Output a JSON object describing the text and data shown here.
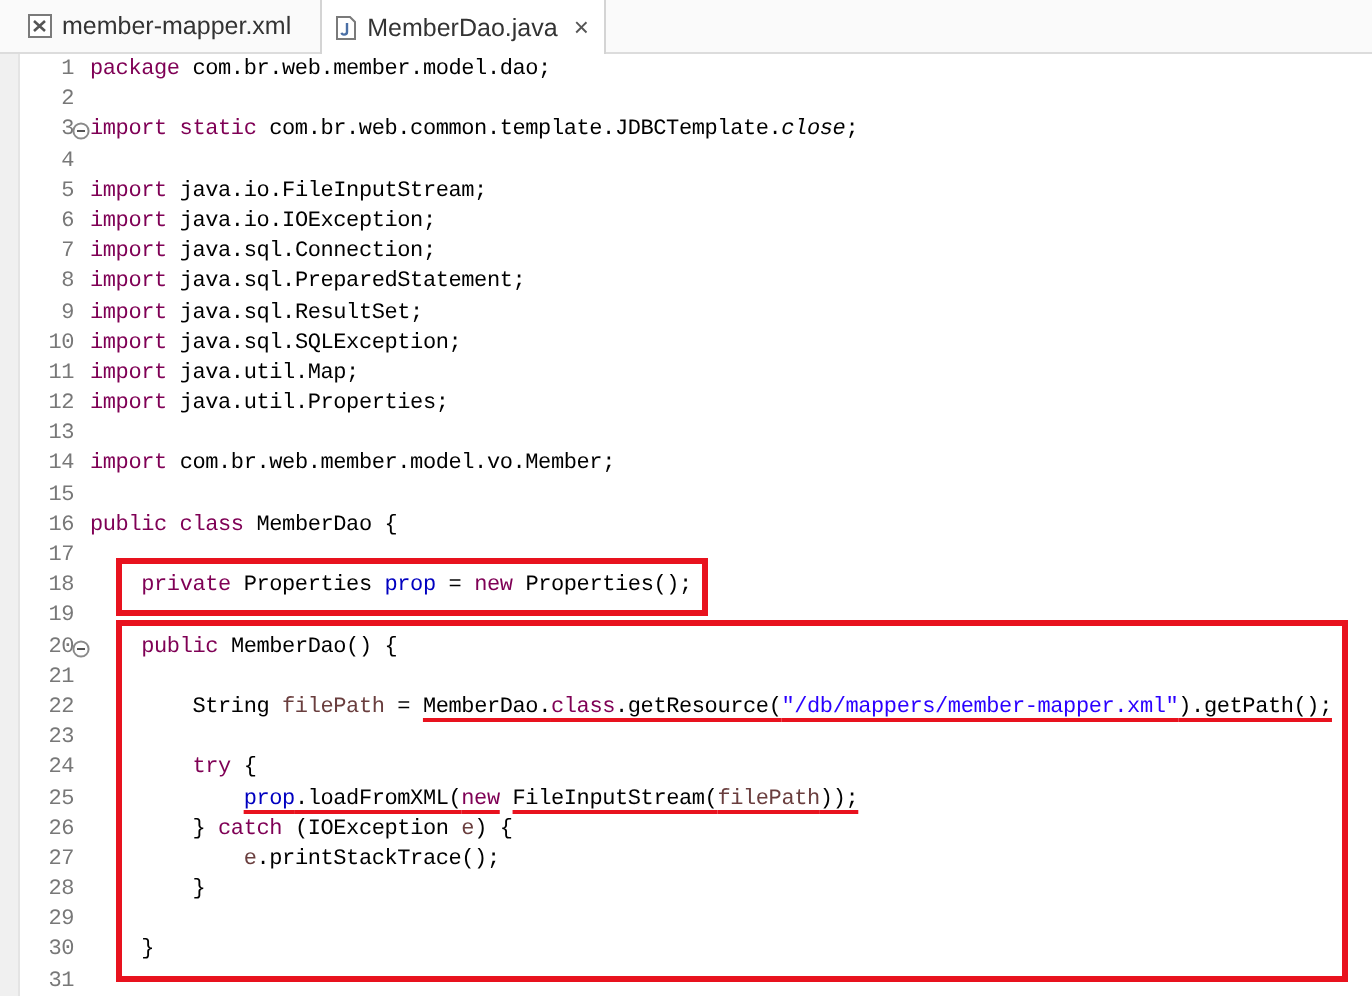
{
  "tabs": [
    {
      "label": "member-mapper.xml",
      "kind": "xml",
      "selected": false
    },
    {
      "label": "MemberDao.java",
      "kind": "java",
      "selected": true
    }
  ],
  "close_glyph": "×",
  "code": [
    {
      "kind": "plain",
      "lines": [
        {
          "number": "1",
          "tokens": [
            {
              "kind": "keyword",
              "text": "package"
            },
            {
              "kind": "plain",
              "text": " com.br.web.member.model.dao;"
            }
          ]
        },
        {
          "number": "2"
        },
        {
          "number": "3",
          "fold": true,
          "tokens": [
            {
              "kind": "keyword",
              "text": "import static"
            },
            {
              "kind": "plain",
              "text": " com.br.web.common.template.JDBCTemplate."
            },
            {
              "kind": "static",
              "text": "close"
            },
            {
              "kind": "plain",
              "text": ";"
            }
          ]
        },
        {
          "number": "4"
        },
        {
          "number": "5",
          "tokens": [
            {
              "kind": "keyword",
              "text": "import"
            },
            {
              "kind": "plain",
              "text": " java.io.FileInputStream;"
            }
          ]
        },
        {
          "number": "6",
          "tokens": [
            {
              "kind": "keyword",
              "text": "import"
            },
            {
              "kind": "plain",
              "text": " java.io.IOException;"
            }
          ]
        },
        {
          "number": "7",
          "tokens": [
            {
              "kind": "keyword",
              "text": "import"
            },
            {
              "kind": "plain",
              "text": " java.sql.Connection;"
            }
          ]
        },
        {
          "number": "8",
          "tokens": [
            {
              "kind": "keyword",
              "text": "import"
            },
            {
              "kind": "plain",
              "text": " java.sql.PreparedStatement;"
            }
          ]
        },
        {
          "number": "9",
          "tokens": [
            {
              "kind": "keyword",
              "text": "import"
            },
            {
              "kind": "plain",
              "text": " java.sql.ResultSet;"
            }
          ]
        },
        {
          "number": "10",
          "tokens": [
            {
              "kind": "keyword",
              "text": "import"
            },
            {
              "kind": "plain",
              "text": " java.sql.SQLException;"
            }
          ]
        },
        {
          "number": "11",
          "tokens": [
            {
              "kind": "keyword",
              "text": "import"
            },
            {
              "kind": "plain",
              "text": " java.util.Map;"
            }
          ]
        },
        {
          "number": "12",
          "tokens": [
            {
              "kind": "keyword",
              "text": "import"
            },
            {
              "kind": "plain",
              "text": " java.util.Properties;"
            }
          ]
        },
        {
          "number": "13"
        },
        {
          "number": "14",
          "tokens": [
            {
              "kind": "keyword",
              "text": "import"
            },
            {
              "kind": "plain",
              "text": " com.br.web.member.model.vo.Member;"
            }
          ]
        },
        {
          "number": "15"
        },
        {
          "number": "16",
          "tokens": [
            {
              "kind": "keyword",
              "text": "public class"
            },
            {
              "kind": "plain",
              "text": " MemberDao {"
            }
          ]
        },
        {
          "number": "17"
        }
      ]
    },
    {
      "kind": "boxed",
      "lines": [
        {
          "number": "18",
          "tokens": [
            {
              "kind": "keyword",
              "text": "    private"
            },
            {
              "kind": "plain",
              "text": " Properties "
            },
            {
              "kind": "field",
              "text": "prop"
            },
            {
              "kind": "plain",
              "text": " = "
            },
            {
              "kind": "keyword",
              "text": "new"
            },
            {
              "kind": "plain",
              "text": " Properties();"
            }
          ]
        }
      ]
    },
    {
      "kind": "plain",
      "lines": [
        {
          "number": "19"
        }
      ]
    },
    {
      "kind": "boxed",
      "lines": [
        {
          "number": "20",
          "fold": true,
          "tokens": [
            {
              "kind": "keyword",
              "text": "    public"
            },
            {
              "kind": "plain",
              "text": " MemberDao() {"
            }
          ]
        },
        {
          "number": "21"
        },
        {
          "number": "22",
          "tokens": [
            {
              "kind": "plain",
              "text": "        String "
            },
            {
              "kind": "local",
              "text": "filePath"
            },
            {
              "kind": "plain",
              "text": " = "
            },
            {
              "kind": "plain",
              "text": "MemberDao.",
              "underlined": true
            },
            {
              "kind": "keyword",
              "text": "class",
              "underlined": true
            },
            {
              "kind": "plain",
              "text": ".getResource(",
              "underlined": true
            },
            {
              "kind": "string",
              "text": "\"/db/mappers/member-mapper.xml\"",
              "underlined": true
            },
            {
              "kind": "plain",
              "text": ").getPath();",
              "underlined": true
            }
          ]
        },
        {
          "number": "23"
        },
        {
          "number": "24",
          "tokens": [
            {
              "kind": "keyword",
              "text": "        try"
            },
            {
              "kind": "plain",
              "text": " {"
            }
          ]
        },
        {
          "number": "25",
          "tokens": [
            {
              "kind": "field",
              "text": "            prop",
              "underlined": true
            },
            {
              "kind": "plain",
              "text": ".loadFromXML(",
              "underlined": true
            },
            {
              "kind": "keyword",
              "text": "new",
              "underlined": true
            },
            {
              "kind": "plain",
              "text": " FileInputStream(",
              "underlined": true
            },
            {
              "kind": "local",
              "text": "filePath",
              "underlined": true
            },
            {
              "kind": "plain",
              "text": "));",
              "underlined": true
            }
          ]
        },
        {
          "number": "26",
          "tokens": [
            {
              "kind": "plain",
              "text": "        } "
            },
            {
              "kind": "keyword",
              "text": "catch"
            },
            {
              "kind": "plain",
              "text": " (IOException "
            },
            {
              "kind": "local",
              "text": "e"
            },
            {
              "kind": "plain",
              "text": ") {"
            }
          ]
        },
        {
          "number": "27",
          "tokens": [
            {
              "kind": "local",
              "text": "            e"
            },
            {
              "kind": "plain",
              "text": ".printStackTrace();"
            }
          ]
        },
        {
          "number": "28",
          "tokens": [
            {
              "kind": "plain",
              "text": "        }"
            }
          ]
        },
        {
          "number": "29"
        },
        {
          "number": "30",
          "tokens": [
            {
              "kind": "plain",
              "text": "    }"
            }
          ]
        }
      ]
    },
    {
      "kind": "plain",
      "lines": [
        {
          "number": "31"
        }
      ]
    }
  ]
}
